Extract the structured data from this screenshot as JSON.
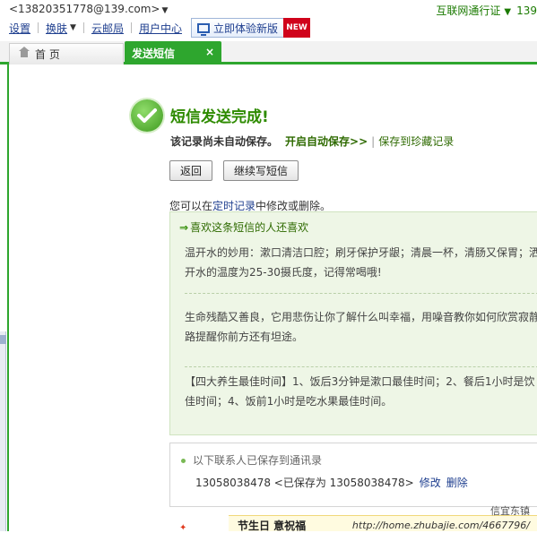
{
  "header": {
    "account": "<13820351778@139.com>",
    "pass_label": "互联网通行证",
    "pass_number": "139",
    "menu": {
      "settings": "设置",
      "skin": "换肤",
      "cloud_post": "云邮局",
      "user_center": "用户中心"
    },
    "new_version": {
      "label": "立即体验新版",
      "badge": "NEW"
    }
  },
  "tabs": {
    "home": "首 页",
    "send": "发送短信",
    "close_symbol": "×"
  },
  "result": {
    "title": "短信发送完成!",
    "save_prefix": "该记录尚未自动保存。",
    "auto_save_link": "开启自动保存>>",
    "bar": "|",
    "save_collection_link": "保存到珍藏记录"
  },
  "buttons": {
    "back": "返回",
    "continue": "继续写短信"
  },
  "note": {
    "prefix": "您可以在",
    "link": "定时记录",
    "suffix": "中修改或删除。"
  },
  "recommend": {
    "arrow": "⇒",
    "heading": "喜欢这条短信的人还喜欢",
    "items": [
      "温开水的妙用：漱口清洁口腔；刷牙保护牙龈；清晨一杯，清肠又保胃；洒开水的温度为25-30摄氏度，记得常喝哦!",
      "生命残酷又善良，它用悲伤让你了解什么叫幸福，用噪音教你如何欣赏寂静路提醒你前方还有坦途。",
      "【四大养生最佳时间】1、饭后3分钟是漱口最佳时间；2、餐后1小时是饮佳时间；4、饭前1小时是吃水果最佳时间。"
    ]
  },
  "contacts": {
    "heading": "以下联系人已保存到通讯录",
    "entry": "13058038478 <已保存为 13058038478>",
    "edit": "修改",
    "delete": "删除"
  },
  "bottom": {
    "label": "节生日 意祝福",
    "watermark_line1": "信宜东镇",
    "watermark_url": "http://home.zhubajie.com/4667796/"
  },
  "colors": {
    "brand_green": "#2ea62e",
    "title_green": "#2e8b00",
    "link_blue": "#1f3f8f",
    "badge_red": "#d0021b"
  }
}
